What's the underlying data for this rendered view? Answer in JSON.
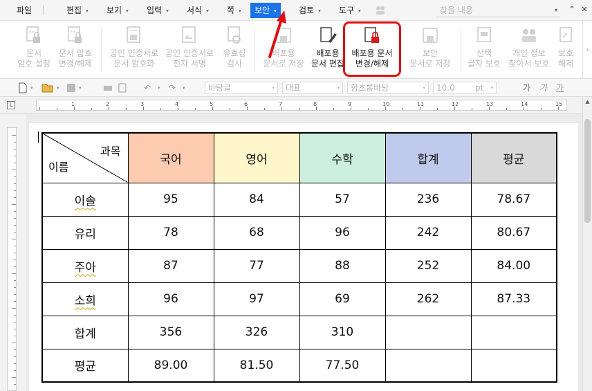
{
  "menu": {
    "items": [
      {
        "label": "파일",
        "has_caret": false
      },
      {
        "label": "편집",
        "has_caret": true
      },
      {
        "label": "보기",
        "has_caret": true
      },
      {
        "label": "입력",
        "has_caret": true
      },
      {
        "label": "서식",
        "has_caret": true
      },
      {
        "label": "쪽",
        "has_caret": true
      },
      {
        "label": "보안",
        "has_caret": true,
        "active": true
      },
      {
        "label": "검토",
        "has_caret": true
      },
      {
        "label": "도구",
        "has_caret": true
      }
    ],
    "search_placeholder": "찾을 내용",
    "caret_glyph": "▾",
    "win_restore": "⌃",
    "win_close": "✕"
  },
  "ribbon": {
    "buttons": [
      {
        "line1": "문서",
        "line2": "암호 설정",
        "enabled": false
      },
      {
        "line1": "문서 암호",
        "line2": "변경/해제",
        "enabled": false
      },
      {
        "line1": "공인 인증서로",
        "line2": "문서 암호화",
        "enabled": false
      },
      {
        "line1": "공인 인증서로",
        "line2": "전자 서명",
        "enabled": false
      },
      {
        "line1": "유효성",
        "line2": "검사",
        "enabled": false
      },
      {
        "line1": "배포용",
        "line2": "문서로 저장",
        "enabled": false
      },
      {
        "line1": "배포용",
        "line2": "문서 편집",
        "enabled": true
      },
      {
        "line1": "배포용 문서",
        "line2": "변경/해제",
        "enabled": true
      },
      {
        "line1": "보안",
        "line2": "문서로 저장",
        "enabled": false
      },
      {
        "line1": "선택",
        "line2": "글자 보호",
        "enabled": false
      },
      {
        "line1": "개인 정보",
        "line2": "찾아서 보호",
        "enabled": false
      },
      {
        "line1": "보호",
        "line2": "해제",
        "enabled": false
      }
    ],
    "scroll_glyph": "›"
  },
  "format_bar": {
    "style_combo": "바탕글",
    "para_combo": "대표",
    "font_combo": "함초롬바탕",
    "size_value": "10.0",
    "size_unit": "pt",
    "bold_glyph": "가",
    "italic_glyph": "가",
    "underline_glyph": "가"
  },
  "ruler": {
    "corner": "L",
    "ticks": [
      "1",
      "2",
      "3",
      "4",
      "5",
      "6",
      "7",
      "8",
      "9",
      "10",
      "11",
      "12",
      "13",
      "14",
      "15"
    ]
  },
  "table": {
    "corner_top": "과목",
    "corner_bottom": "이름",
    "headers": [
      {
        "label": "국어",
        "color": "#fdcbb0"
      },
      {
        "label": "영어",
        "color": "#fff6cc"
      },
      {
        "label": "수학",
        "color": "#ccefdf"
      },
      {
        "label": "합계",
        "color": "#bfcaec"
      },
      {
        "label": "평균",
        "color": "#d9d9d9"
      }
    ],
    "rows": [
      {
        "name": "이솔",
        "values": [
          "95",
          "84",
          "57",
          "236",
          "78.67"
        ]
      },
      {
        "name": "유리",
        "values": [
          "78",
          "68",
          "96",
          "242",
          "80.67"
        ]
      },
      {
        "name": "주아",
        "values": [
          "87",
          "77",
          "88",
          "252",
          "84.00"
        ]
      },
      {
        "name": "소희",
        "values": [
          "96",
          "97",
          "69",
          "262",
          "87.33"
        ]
      }
    ],
    "total_row": {
      "name": "합계",
      "values": [
        "356",
        "326",
        "310",
        "",
        ""
      ]
    },
    "avg_row": {
      "name": "평균",
      "values": [
        "89.00",
        "81.50",
        "77.50",
        "",
        ""
      ]
    }
  },
  "annotation": {
    "highlight_color": "#e01010"
  }
}
